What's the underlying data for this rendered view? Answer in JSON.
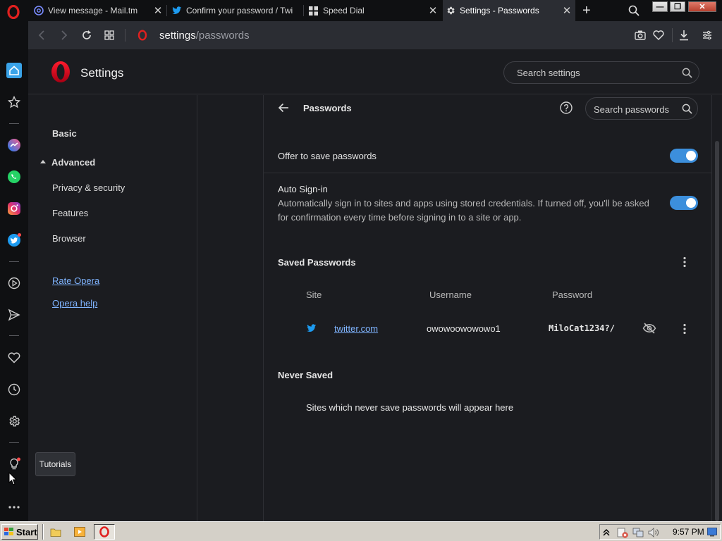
{
  "browser": {
    "tabs": [
      {
        "title": "View message - Mail.tm",
        "icon": "mail-icon",
        "active": false
      },
      {
        "title": "Confirm your password / Twi",
        "icon": "twitter-icon",
        "active": false
      },
      {
        "title": "Speed Dial",
        "icon": "grid-icon",
        "active": false
      },
      {
        "title": "Settings - Passwords",
        "icon": "gear-icon",
        "active": true
      }
    ],
    "close_glyph": "✕",
    "new_tab_glyph": "+",
    "window_buttons": {
      "minimize": "—",
      "restore": "❐",
      "close": "✕"
    },
    "url": {
      "host": "settings",
      "path": "/passwords"
    }
  },
  "settings": {
    "title": "Settings",
    "search_placeholder": "Search settings",
    "nav": {
      "basic": "Basic",
      "advanced": "Advanced",
      "privacy": "Privacy & security",
      "features": "Features",
      "browser": "Browser",
      "rate_opera": "Rate Opera",
      "opera_help": "Opera help"
    }
  },
  "passwords": {
    "header": "Passwords",
    "search_placeholder": "Search passwords",
    "offer_to_save": {
      "label": "Offer to save passwords",
      "enabled": true
    },
    "auto_signin": {
      "label": "Auto Sign-in",
      "description_line1": "Automatically sign in to sites and apps using stored credentials. If turned off, you'll be asked",
      "description_line2": "for confirmation every time before signing in to a site or app.",
      "enabled": true
    },
    "saved_heading": "Saved Passwords",
    "columns": {
      "site": "Site",
      "username": "Username",
      "password": "Password"
    },
    "entries": [
      {
        "site": "twitter.com",
        "username": "owowoowowowo1",
        "password": "MiloCat1234?/"
      }
    ],
    "never_saved_heading": "Never Saved",
    "never_saved_empty": "Sites which never save passwords will appear here"
  },
  "tooltip": "Tutorials",
  "taskbar": {
    "start": "Start",
    "clock": "9:57 PM"
  },
  "colors": {
    "accent": "#3c8fdc",
    "opera_red": "#e0201f",
    "twitter_blue": "#1d9bf0"
  }
}
